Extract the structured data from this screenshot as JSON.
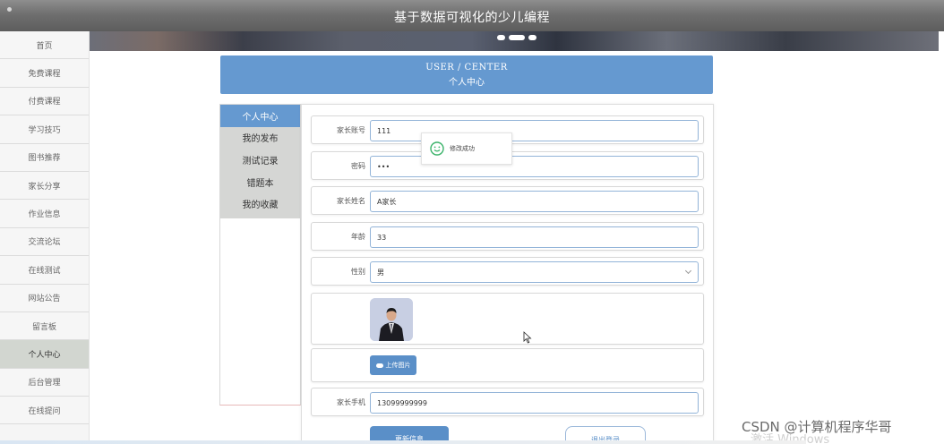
{
  "header": {
    "title": "基于数据可视化的少儿编程"
  },
  "sidebar": {
    "items": [
      {
        "label": "首页",
        "active": false
      },
      {
        "label": "免费课程",
        "active": false
      },
      {
        "label": "付费课程",
        "active": false
      },
      {
        "label": "学习技巧",
        "active": false
      },
      {
        "label": "图书推荐",
        "active": false
      },
      {
        "label": "家长分享",
        "active": false
      },
      {
        "label": "作业信息",
        "active": false
      },
      {
        "label": "交流论坛",
        "active": false
      },
      {
        "label": "在线测试",
        "active": false
      },
      {
        "label": "网站公告",
        "active": false
      },
      {
        "label": "留言板",
        "active": false
      },
      {
        "label": "个人中心",
        "active": true
      },
      {
        "label": "后台管理",
        "active": false
      },
      {
        "label": "在线提问",
        "active": false
      }
    ]
  },
  "center": {
    "title_en": "USER / CENTER",
    "title_zh": "个人中心"
  },
  "tabs": [
    {
      "label": "个人中心",
      "active": true
    },
    {
      "label": "我的发布",
      "active": false
    },
    {
      "label": "测试记录",
      "active": false
    },
    {
      "label": "错题本",
      "active": false
    },
    {
      "label": "我的收藏",
      "active": false
    }
  ],
  "form": {
    "account": {
      "label": "家长账号",
      "value": "111"
    },
    "password": {
      "label": "密码",
      "value": "•••"
    },
    "name": {
      "label": "家长姓名",
      "value": "A家长"
    },
    "age": {
      "label": "年龄",
      "value": "33"
    },
    "gender": {
      "label": "性别",
      "value": "男"
    },
    "upload_label": "上传图片",
    "phone": {
      "label": "家长手机",
      "value": "13099999999"
    },
    "submit_label": "更新信息",
    "logout_label": "退出登录"
  },
  "toast": {
    "message": "修改成功"
  },
  "watermark": {
    "csdn": "CSDN @计算机程序华哥",
    "windows": "激活 Windows"
  },
  "colors": {
    "accent": "#6599d0",
    "button": "#5a8fc8",
    "toast_icon": "#3bb36a"
  }
}
